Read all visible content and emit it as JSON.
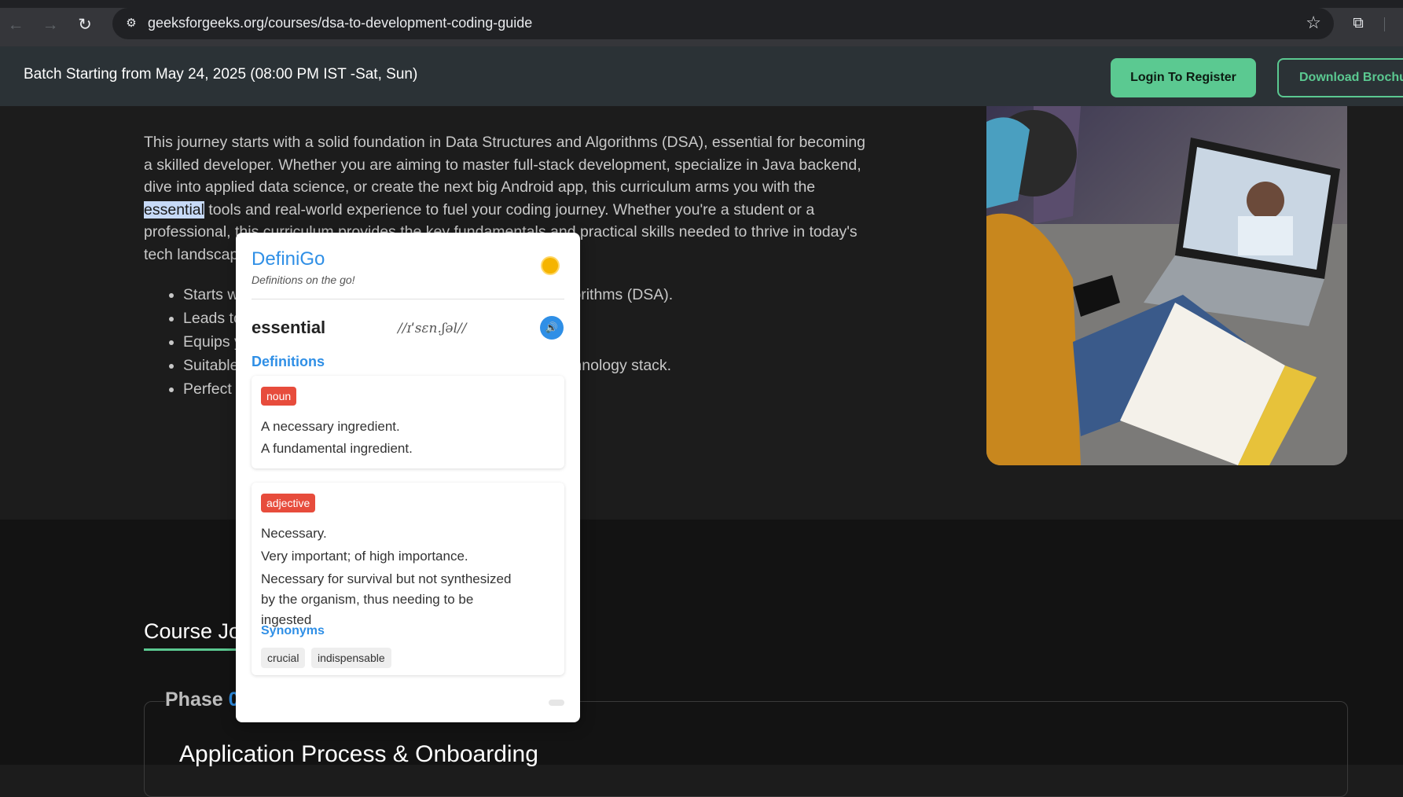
{
  "browser": {
    "url": "geeksforgeeks.org/courses/dsa-to-development-coding-guide",
    "icons": [
      "back-arrow-icon",
      "forward-arrow-icon",
      "reload-icon",
      "site-info-icon",
      "star-icon",
      "extensions-icon"
    ]
  },
  "banner": {
    "text": "Batch Starting from May 24, 2025 (08:00 PM IST -Sat, Sun)",
    "login_label": "Login To Register",
    "brochure_label": "Download Brochure"
  },
  "main": {
    "intro_before": "This journey starts with a solid foundation in Data Structures and Algorithms (DSA), essential for becoming a skilled developer. Whether you are aiming to master full-stack development, specialize in Java backend, dive into applied data science, or create the next big Android app, this curriculum arms you with the ",
    "intro_highlight": "essential",
    "intro_after": " tools and real-world experience to fuel your coding journey. Whether you're a student or a professional, this curriculum provides the key fundamentals and practical skills needed to thrive in today's tech landscape.",
    "bullets": [
      "Starts with a strong foundation in Data Structures and Algorithms (DSA).",
      "Leads to practical development skills.",
      "Equips you with real-world experience.",
      "Suitable for those aiming at specializing in a particular technology stack.",
      "Perfect for anyone looking for a technological journey."
    ]
  },
  "lower": {
    "journey_title": "Course Journey",
    "phase_prefix": "Phase ",
    "phase_number": "01",
    "phase_title": "Application Process & Onboarding"
  },
  "popup": {
    "title": "DefiniGo",
    "tagline": "Definitions on the go!",
    "word": "essential",
    "phonetic": "//ɪˈsɛn.ʃəl//",
    "definitions_heading": "Definitions",
    "noun": {
      "pos": "noun",
      "defs": [
        "A necessary ingredient.",
        "A fundamental ingredient."
      ]
    },
    "adjective": {
      "pos": "adjective",
      "defs": [
        "Necessary.",
        "Very important; of high importance.",
        "Necessary for survival but not synthesized by the organism, thus needing to be ingested"
      ],
      "synonyms_heading": "Synonyms",
      "synonyms": [
        "crucial",
        "indispensable"
      ]
    }
  }
}
